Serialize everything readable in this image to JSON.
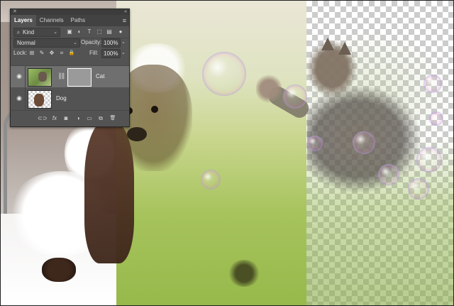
{
  "panel": {
    "close_glyph": "✕",
    "collapse_glyph": "«",
    "menu_glyph": "≡",
    "tabs": [
      {
        "label": "Layers",
        "active": true
      },
      {
        "label": "Channels",
        "active": false
      },
      {
        "label": "Paths",
        "active": false
      }
    ],
    "filter": {
      "search_glyph": "⌕",
      "kind_label": "Kind",
      "chevron": "⌄",
      "icons": [
        {
          "name": "image-filter-icon",
          "glyph": "▣"
        },
        {
          "name": "adjustment-filter-icon",
          "glyph": "◐"
        },
        {
          "name": "type-filter-icon",
          "glyph": "T"
        },
        {
          "name": "shape-filter-icon",
          "glyph": "⬚"
        },
        {
          "name": "smart-object-filter-icon",
          "glyph": "▤"
        },
        {
          "name": "filter-toggle-icon",
          "glyph": "●"
        }
      ]
    },
    "blend_mode": "Normal",
    "blend_chevron": "⌄",
    "opacity_label": "Opacity:",
    "opacity_value": "100%",
    "side_chevron": "⌄",
    "lock_label": "Lock:",
    "lock_icons": [
      {
        "name": "lock-transparent-pixels-icon",
        "glyph": "⊞"
      },
      {
        "name": "lock-image-pixels-icon",
        "glyph": "✎"
      },
      {
        "name": "lock-position-icon",
        "glyph": "✥"
      },
      {
        "name": "lock-artboard-icon",
        "glyph": "⌗"
      },
      {
        "name": "lock-all-icon",
        "glyph": "🔒"
      }
    ],
    "fill_label": "Fill:",
    "fill_value": "100%",
    "layers": [
      {
        "name": "Cat",
        "visible": true,
        "selected": true,
        "has_mask": true
      },
      {
        "name": "Dog",
        "visible": true,
        "selected": false,
        "has_mask": false
      }
    ],
    "eye_glyph": "◉",
    "link_glyph": "⛓",
    "footer_icons": [
      {
        "name": "link-layers-icon",
        "glyph": "⊂⊃"
      },
      {
        "name": "layer-style-icon",
        "glyph": "fx"
      },
      {
        "name": "add-mask-icon",
        "glyph": "◙"
      },
      {
        "name": "new-adjustment-icon",
        "glyph": "◑"
      },
      {
        "name": "new-group-icon",
        "glyph": "▭"
      },
      {
        "name": "new-layer-icon",
        "glyph": "⧉"
      },
      {
        "name": "delete-layer-icon",
        "glyph": "🗑"
      }
    ]
  },
  "colors": {
    "panel_bg": "#535353",
    "selected_layer_bg": "#6f6f6f",
    "tab_bar_bg": "#424242"
  }
}
